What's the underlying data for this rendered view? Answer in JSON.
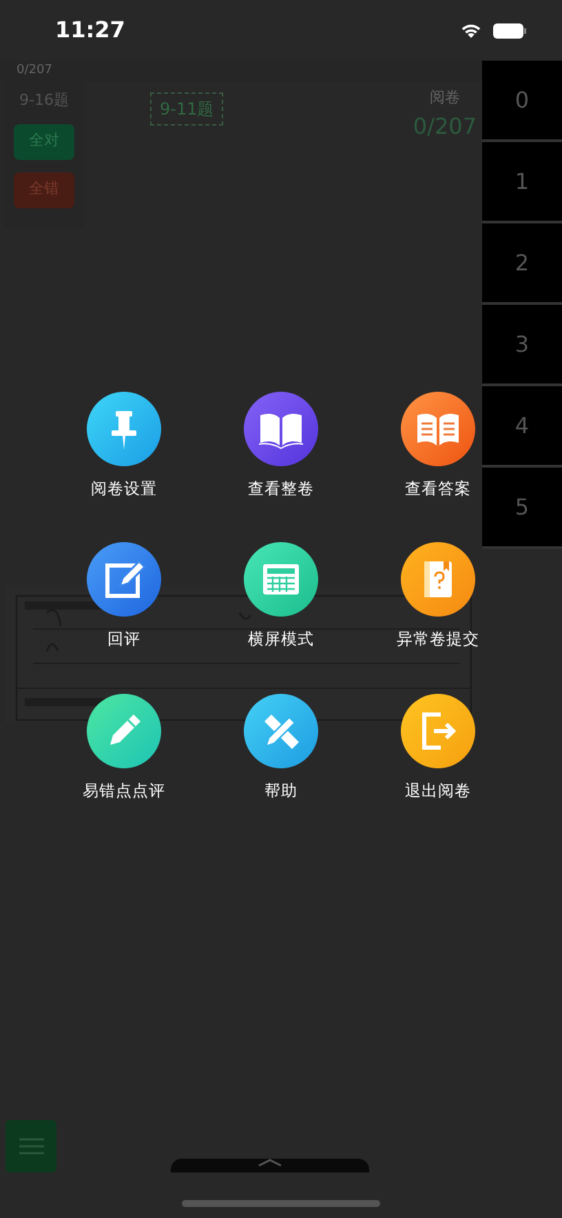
{
  "status_bar": {
    "time": "11:27"
  },
  "header": {
    "progress": "0/207"
  },
  "left_panel": {
    "question_group": "9-16题",
    "buttons": [
      {
        "label": "全对",
        "kind": "correct"
      },
      {
        "label": "全错",
        "kind": "wrong"
      }
    ]
  },
  "question_tabs": [
    {
      "label": "9-11题"
    }
  ],
  "review": {
    "label": "阅卷",
    "count": "0/207"
  },
  "score_keys": [
    "0",
    "1",
    "2",
    "3",
    "4",
    "5"
  ],
  "menu": [
    {
      "label": "阅卷设置"
    },
    {
      "label": "查看整卷"
    },
    {
      "label": "查看答案"
    },
    {
      "label": "回评"
    },
    {
      "label": "横屏模式"
    },
    {
      "label": "异常卷提交"
    },
    {
      "label": "易错点点评"
    },
    {
      "label": "帮助"
    },
    {
      "label": "退出阅卷"
    }
  ]
}
